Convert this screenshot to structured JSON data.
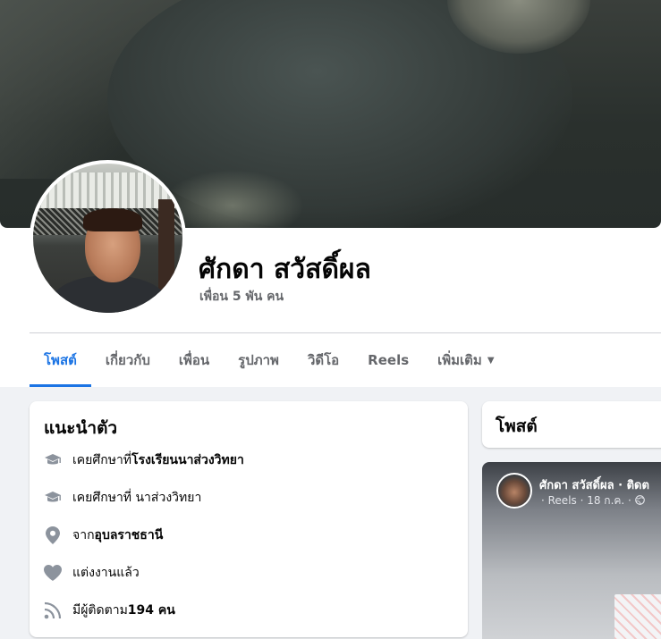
{
  "profile": {
    "name": "ศักดา สวัสดิ์ผล",
    "friends": "เพื่อน 5 พัน คน"
  },
  "tabs": [
    {
      "label": "โพสต์",
      "active": true
    },
    {
      "label": "เกี่ยวกับ"
    },
    {
      "label": "เพื่อน"
    },
    {
      "label": "รูปภาพ"
    },
    {
      "label": "วิดีโอ"
    },
    {
      "label": "Reels"
    },
    {
      "label": "เพิ่มเติม",
      "icon": "caret-down-icon"
    }
  ],
  "intro": {
    "title": "แนะนำตัว",
    "rows": [
      {
        "icon": "graduation-cap-icon",
        "prefix": "เคยศึกษาที่ ",
        "bold": "โรงเรียนนาส่วงวิทยา",
        "suffix": ""
      },
      {
        "icon": "graduation-cap-icon",
        "prefix": "เคยศึกษาที่ นาส่วงวิทยา",
        "bold": "",
        "suffix": ""
      },
      {
        "icon": "location-pin-icon",
        "prefix": "จาก ",
        "bold": "อุบลราชธานี",
        "suffix": ""
      },
      {
        "icon": "heart-icon",
        "prefix": "แต่งงานแล้ว",
        "bold": "",
        "suffix": ""
      },
      {
        "icon": "rss-followers-icon",
        "prefix": "มีผู้ติดตาม ",
        "bold": "194 คน",
        "suffix": ""
      }
    ]
  },
  "posts": {
    "title": "โพสต์"
  },
  "reel": {
    "author": "ศักดา สวัสดิ์ผล · ติดต",
    "meta": "· Reels · 18 ก.ค. · ",
    "privacy_icon": "globe-icon"
  },
  "colors": {
    "accent": "#1b74e4",
    "secondary_text": "#65676b",
    "feed_background": "#f0f2f5"
  }
}
